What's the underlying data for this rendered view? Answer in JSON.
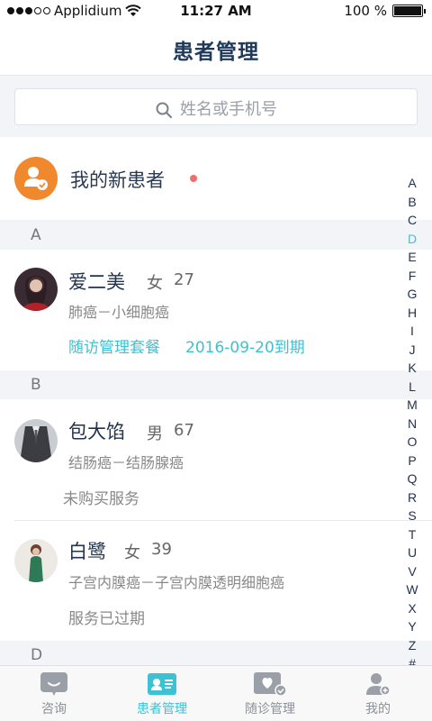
{
  "status": {
    "carrier": "Applidium",
    "time": "11:27 AM",
    "battery": "100 %"
  },
  "nav": {
    "title": "患者管理"
  },
  "search": {
    "placeholder": "姓名或手机号"
  },
  "new_patients": {
    "label": "我的新患者"
  },
  "sections": [
    {
      "letter": "A"
    },
    {
      "letter": "B"
    },
    {
      "letter": "D"
    }
  ],
  "patients": [
    {
      "name": "爱二美",
      "gender": "女",
      "age": "27",
      "diagnosis": "肺癌－小细胞癌",
      "service": "随访管理套餐",
      "expiry": "2016-09-20到期"
    },
    {
      "name": "包大馅",
      "gender": "男",
      "age": "67",
      "diagnosis": "结肠癌－结肠腺癌",
      "service": "未购买服务"
    },
    {
      "name": "白鹭",
      "gender": "女",
      "age": "39",
      "diagnosis": "子宫内膜癌－子宫内膜透明细胞癌",
      "service": "服务已过期"
    }
  ],
  "alpha_index": [
    "A",
    "B",
    "C",
    "D",
    "E",
    "F",
    "G",
    "H",
    "I",
    "J",
    "K",
    "L",
    "M",
    "N",
    "O",
    "P",
    "Q",
    "R",
    "S",
    "T",
    "U",
    "V",
    "W",
    "X",
    "Y",
    "Z",
    "#"
  ],
  "alpha_active": "D",
  "tabs": [
    {
      "label": "咨询",
      "icon": "chat-icon"
    },
    {
      "label": "患者管理",
      "icon": "patient-card-icon"
    },
    {
      "label": "随诊管理",
      "icon": "heart-check-icon"
    },
    {
      "label": "我的",
      "icon": "user-icon"
    }
  ],
  "colors": {
    "accent": "#3ec1d3",
    "title": "#1f3a5b",
    "orange": "#f0882e",
    "dot": "#f36c6c"
  }
}
